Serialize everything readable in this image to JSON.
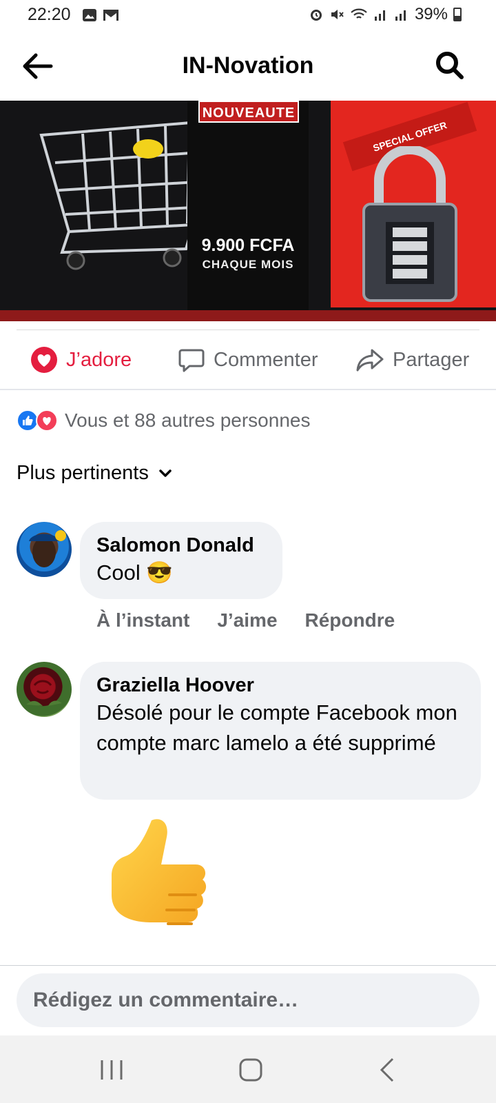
{
  "status_bar": {
    "time": "22:20",
    "battery": "39%",
    "icons": [
      "image-icon",
      "gmail-icon",
      "alarm-icon",
      "mute-icon",
      "wifi-icon",
      "signal-icon",
      "signal-icon",
      "battery-icon"
    ]
  },
  "header": {
    "title": "IN-Novation",
    "back_icon": "back-arrow-icon",
    "search_icon": "search-icon"
  },
  "post": {
    "banner": {
      "badge": "NOUVEAUTE",
      "price": "9.900 FCFA",
      "period": "CHAQUE MOIS",
      "ribbon": "SPECIAL OFFER"
    },
    "actions": {
      "love_label": "J’adore",
      "comment_label": "Commenter",
      "share_label": "Partager"
    },
    "reactions_summary": "Vous et 88 autres personnes",
    "sort_label": "Plus pertinents",
    "colors": {
      "love": "#e41e3f",
      "like": "#1877f2",
      "muted_text": "#65676b",
      "bubble_bg": "#f0f2f5"
    }
  },
  "comments": [
    {
      "author": "Salomon Donald",
      "text": "Cool 😎",
      "time": "À l’instant",
      "like_label": "J’aime",
      "reply_label": "Répondre"
    },
    {
      "author": "Graziella Hoover",
      "text": "Désolé pour le compte Facebook mon compte marc lamelo a été supprimé",
      "sticker": "thumbs-up-sticker"
    }
  ],
  "composer": {
    "placeholder": "Rédigez un commentaire…"
  },
  "nav_bar": {
    "items": [
      "recents-icon",
      "home-icon",
      "back-icon"
    ]
  }
}
